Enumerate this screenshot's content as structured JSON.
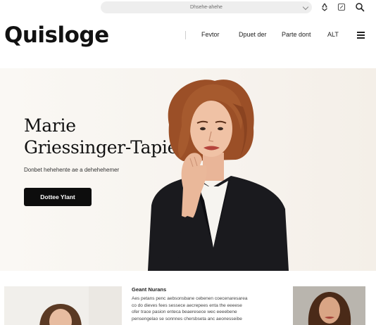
{
  "browser": {
    "url": "Dhsehe-ahehe"
  },
  "header": {
    "logo": "Quisloge",
    "nav": [
      "Fevtor",
      "Dpuet der",
      "Parte dont",
      "ALT"
    ]
  },
  "hero": {
    "title_line1": "Marie",
    "title_line2": "Griessinger-Tapie",
    "subtitle": "Donbet hehehente ae a dehehehemer",
    "button_label": "Dottee Ylant"
  },
  "article": {
    "title": "Geant Nurans",
    "lines": [
      "Aes petans penc aebsonsbane cebenen coecenaresarea",
      "co do dieves fees sessece aecrepees enta the eeeese",
      "ofer trace pasion enteca beaeresece wec eeeebene",
      "pensengelao se sonnnes chersbseta anc aeonesseibe"
    ]
  },
  "colors": {
    "hero_bg": "#f7f3ee",
    "button_bg": "#0d0d0d",
    "hair": "#a0542a",
    "jacket": "#1a1a1e"
  }
}
